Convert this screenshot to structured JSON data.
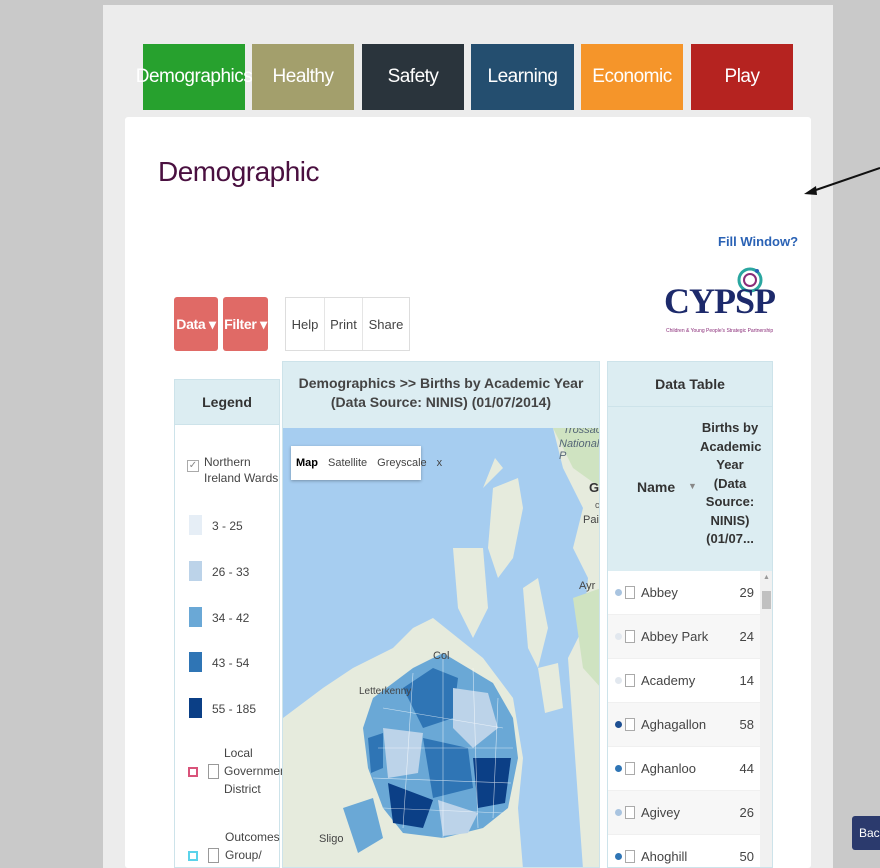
{
  "nav_tabs": [
    {
      "label": "Demographics",
      "color": "#27a12e"
    },
    {
      "label": "Healthy",
      "color": "#a39f6c"
    },
    {
      "label": "Safety",
      "color": "#2a343c"
    },
    {
      "label": "Learning",
      "color": "#244e6f"
    },
    {
      "label": "Economic",
      "color": "#f5952a"
    },
    {
      "label": "Play",
      "color": "#b52320"
    }
  ],
  "page": {
    "title": "Demographic",
    "fill_window": "Fill Window?",
    "logo_text": "CYPSP",
    "logo_subtitle": "Children & Young People's Strategic Partnership",
    "back_label": "Back"
  },
  "toolbar": {
    "data_label": "Data ▾",
    "filter_label": "Filter ▾",
    "help": "Help",
    "print": "Print",
    "share": "Share"
  },
  "legend": {
    "title": "Legend",
    "layer_label": "Northern Ireland Wards",
    "ranges": [
      {
        "label": "3 - 25",
        "color": "#e6eef6"
      },
      {
        "label": "26 - 33",
        "color": "#bcd3e9"
      },
      {
        "label": "34 - 42",
        "color": "#6aa8d6"
      },
      {
        "label": "43 - 54",
        "color": "#2f75b5"
      },
      {
        "label": "55 - 185",
        "color": "#0b3f86"
      }
    ],
    "lgd_label": "Local Government District",
    "outcomes_label": "Outcomes Group/"
  },
  "map": {
    "header": "Demographics >> Births by Academic Year (Data Source: NINIS) (01/07/2014)",
    "controls": [
      "Map",
      "Satellite",
      "Greyscale",
      "x"
    ],
    "places": [
      "Trossac",
      "National P",
      "Gl",
      "c",
      "Pais",
      "Ayr",
      "Col",
      "Letterkenny",
      "Sligo"
    ]
  },
  "data_table": {
    "title": "Data Table",
    "col_name": "Name",
    "col_value": "Births by Academic Year (Data Source: NINIS) (01/07...",
    "rows": [
      {
        "name": "Abbey",
        "value": "29",
        "dot": "#a9c4e0"
      },
      {
        "name": "Abbey Park",
        "value": "24",
        "dot": "#e2e8ef"
      },
      {
        "name": "Academy",
        "value": "14",
        "dot": "#e2e8ef"
      },
      {
        "name": "Aghagallon",
        "value": "58",
        "dot": "#1d4f92"
      },
      {
        "name": "Aghanloo",
        "value": "44",
        "dot": "#2f75b5"
      },
      {
        "name": "Agivey",
        "value": "26",
        "dot": "#a9c4e0"
      },
      {
        "name": "Ahoghill",
        "value": "50",
        "dot": "#2f75b5"
      }
    ]
  }
}
